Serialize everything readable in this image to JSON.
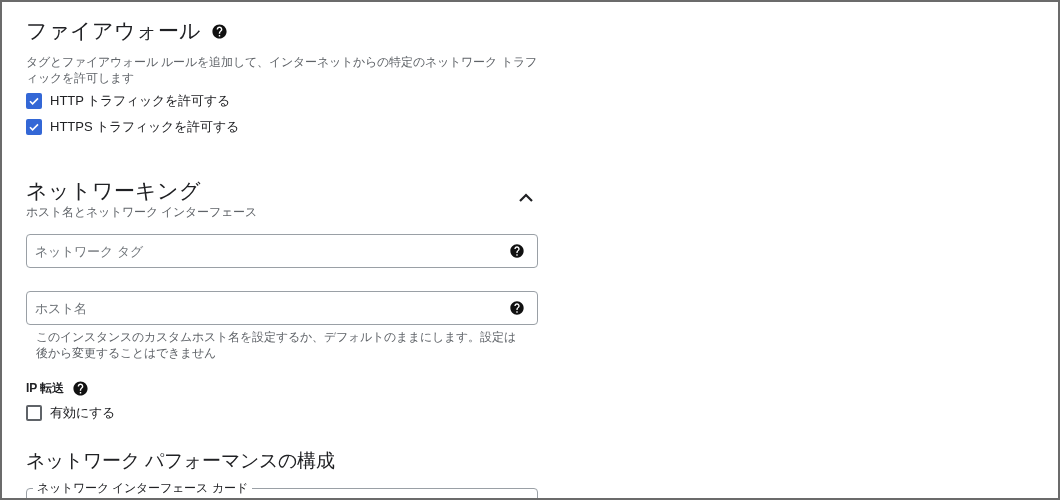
{
  "firewall": {
    "title": "ファイアウォール",
    "description": "タグとファイアウォール ルールを追加して、インターネットからの特定のネットワーク トラフィックを許可します",
    "options": [
      {
        "label": "HTTP トラフィックを許可する",
        "checked": true
      },
      {
        "label": "HTTPS トラフィックを許可する",
        "checked": true
      }
    ]
  },
  "networking": {
    "title": "ネットワーキング",
    "subtitle": "ホスト名とネットワーク インターフェース",
    "expanded": true,
    "fields": [
      {
        "placeholder": "ネットワーク タグ"
      },
      {
        "placeholder": "ホスト名",
        "helper": "このインスタンスのカスタムホスト名を設定するか、デフォルトのままにします。設定は後から変更することはできません"
      }
    ],
    "ip_forwarding": {
      "label": "IP 転送",
      "option": {
        "label": "有効にする",
        "checked": false
      }
    },
    "performance": {
      "title": "ネットワーク パフォーマンスの構成",
      "nic_label": "ネットワーク インターフェース カード"
    }
  }
}
